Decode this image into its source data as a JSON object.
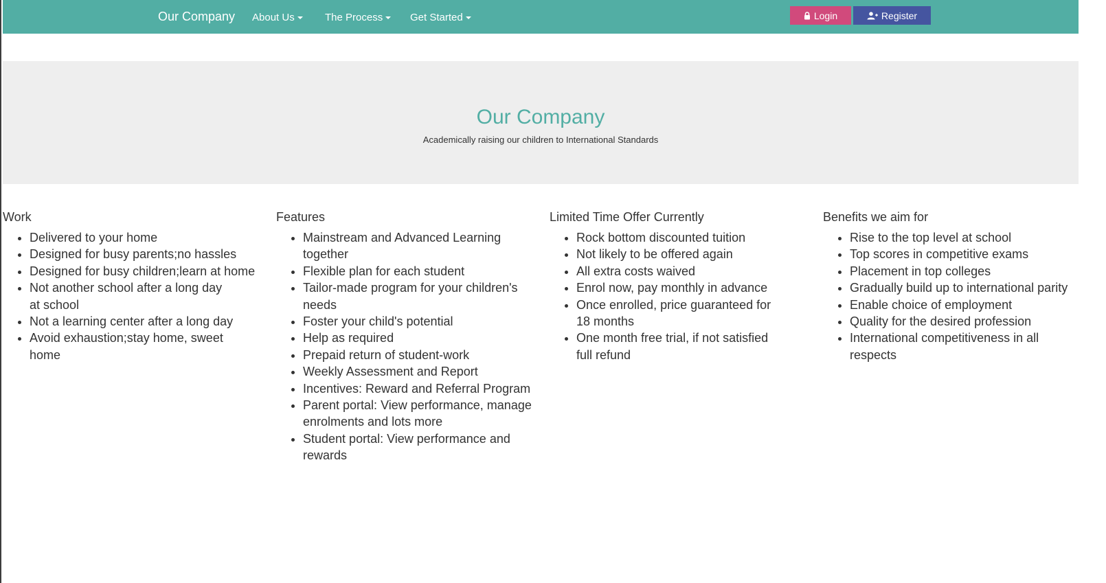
{
  "navbar": {
    "brand": "Our Company",
    "links": [
      {
        "label": "About Us"
      },
      {
        "label": "The Process"
      },
      {
        "label": "Get Started"
      }
    ],
    "login_label": "Login",
    "register_label": "Register",
    "background_color": "#52aea4",
    "login_color": "#d14a7c",
    "register_color": "#4555a0"
  },
  "hero": {
    "title": "Our Company",
    "subtitle": "Academically raising our children to International Standards",
    "title_color": "#52aea4",
    "background_color": "#eeeeee"
  },
  "columns": [
    {
      "heading": "Work",
      "items": [
        "Delivered to your home",
        "Designed for busy parents;no hassles",
        "Designed for busy children;learn at home",
        "Not another school after a long day at school",
        "Not a learning center after a long day",
        "Avoid exhaustion;stay home, sweet home"
      ]
    },
    {
      "heading": "Features",
      "items": [
        "Mainstream and Advanced Learning together",
        "Flexible plan for each student",
        "Tailor-made program for your children's needs",
        "Foster your child's potential",
        "Help as required",
        "Prepaid return of student-work",
        "Weekly Assessment and Report",
        "Incentives: Reward and Referral Program",
        "Parent portal: View performance, manage enrolments and lots more",
        "Student portal: View performance and rewards"
      ]
    },
    {
      "heading": "Limited Time Offer Currently",
      "items": [
        "Rock bottom discounted tuition",
        "Not likely to be offered again",
        "All extra costs waived",
        "Enrol now, pay monthly in advance",
        "Once enrolled, price guaranteed for 18 months",
        "One month free trial, if not satisfied full refund"
      ]
    },
    {
      "heading": "Benefits we aim for",
      "items": [
        "Rise to the top level at school",
        "Top scores in competitive exams",
        "Placement in top colleges",
        "Gradually build up to international parity",
        "Enable choice of employment",
        "Quality for the desired profession",
        "International competitiveness in all respects"
      ]
    }
  ]
}
